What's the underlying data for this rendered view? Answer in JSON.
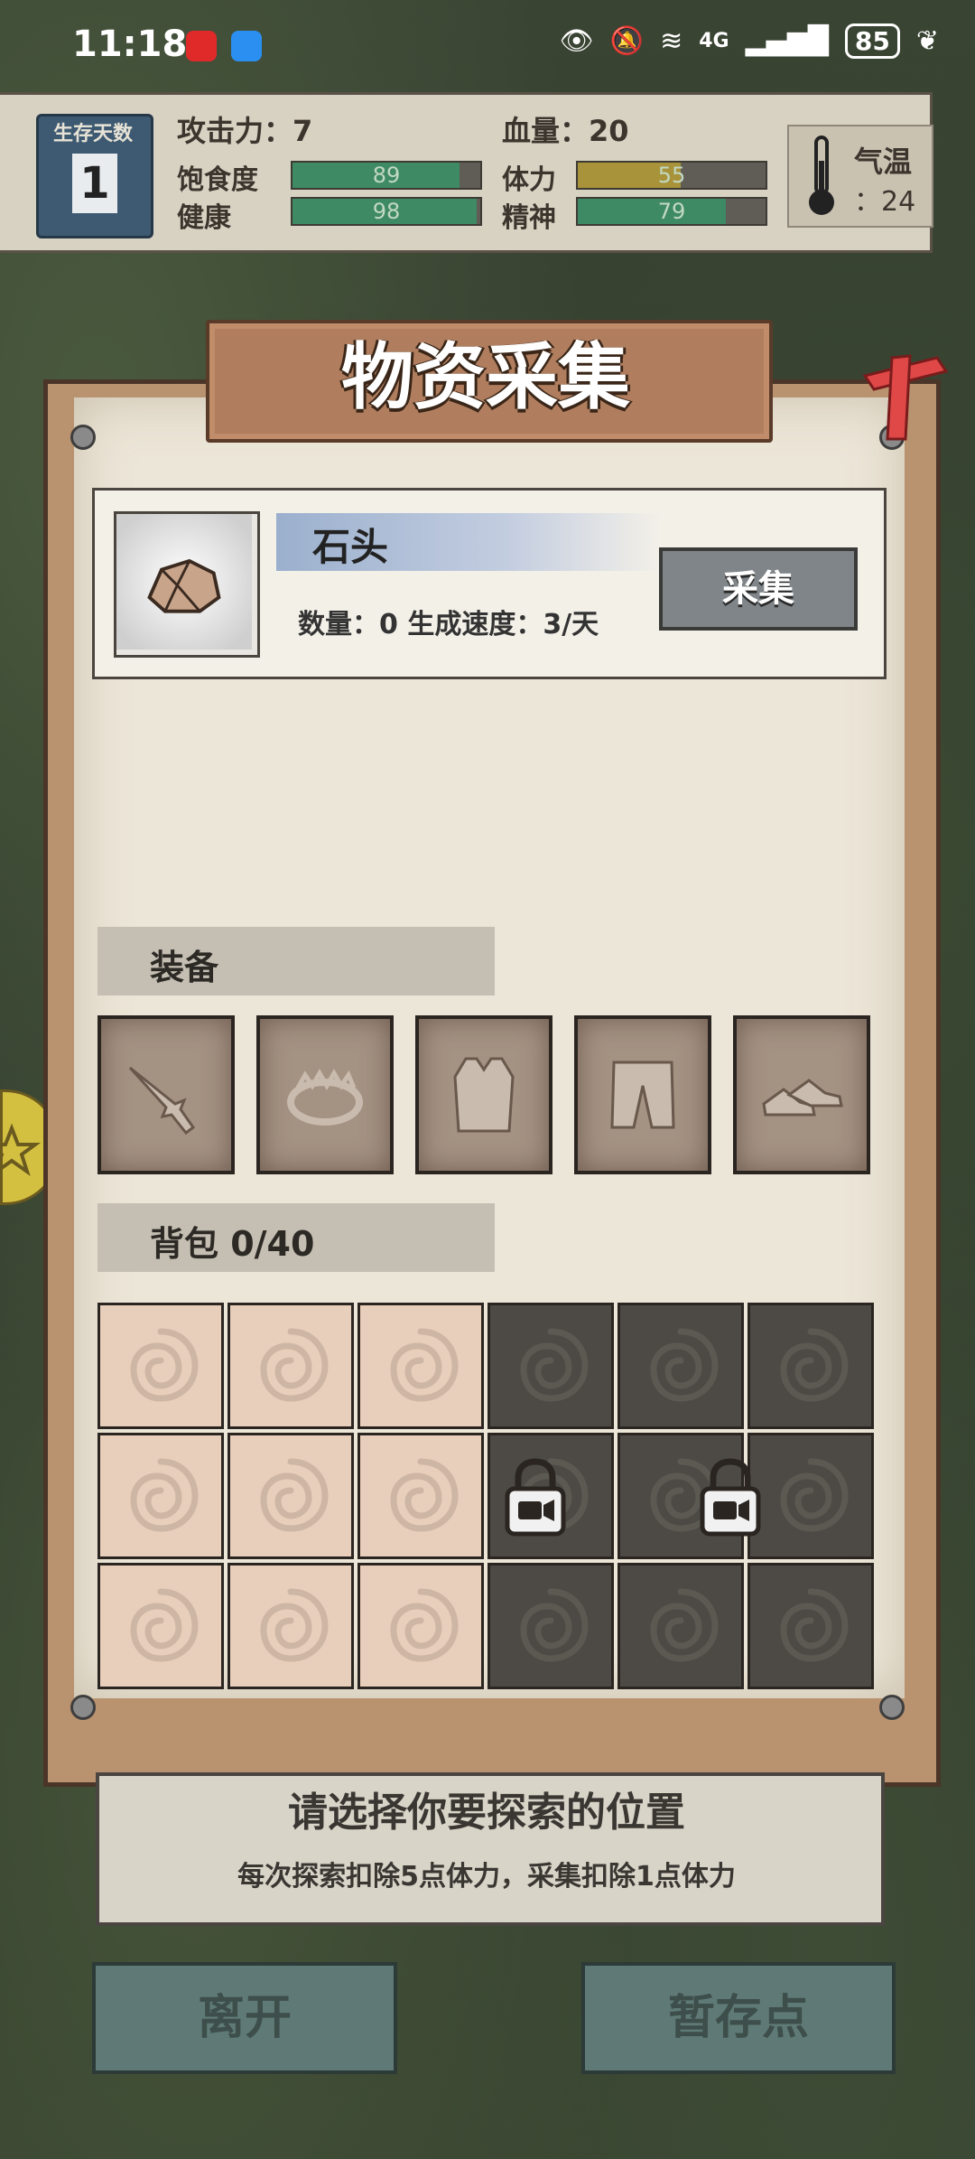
{
  "status_bar": {
    "time": "11:18",
    "network": "4G",
    "battery": "85"
  },
  "stats": {
    "days_label": "生存天数",
    "days_value": "1",
    "attack_label": "攻击力：",
    "attack_value": "7",
    "hp_label": "血量：",
    "hp_value": "20",
    "satiety_label": "饱食度",
    "satiety_value": "89",
    "stamina_label": "体力",
    "stamina_value": "55",
    "health_label": "健康",
    "health_value": "98",
    "spirit_label": "精神",
    "spirit_value": "79",
    "temp_label": "气温",
    "temp_value": "：24"
  },
  "dialog": {
    "title": "物资采集",
    "resource": {
      "name": "石头",
      "detail": "数量：0   生成速度：3/天",
      "gather_label": "采集"
    },
    "equipment_label": "装备",
    "equipment_slots": [
      "weapon-knife-icon",
      "trap-icon",
      "armor-vest-icon",
      "pants-icon",
      "shoes-icon"
    ],
    "backpack_label": "背包 0/40"
  },
  "info": {
    "title": "请选择你要探索的位置",
    "subtitle": "每次探索扣除5点体力，采集扣除1点体力"
  },
  "buttons": {
    "leave": "离开",
    "save_point": "暂存点"
  },
  "colors": {
    "bar_green": "#3e8a64",
    "bar_yellow": "#a8923a",
    "paper": "#ece6d8",
    "slot_open": "#e8cfbb",
    "slot_locked": "#4d4a45"
  }
}
